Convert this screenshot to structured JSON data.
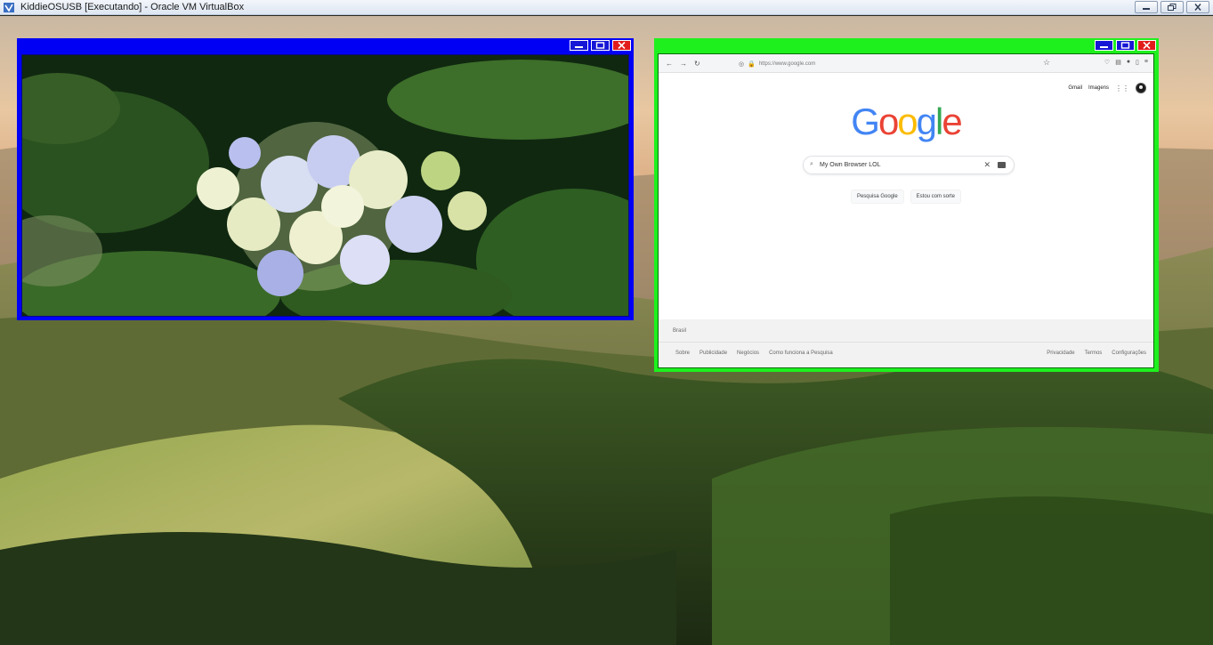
{
  "host": {
    "title": "KiddieOSUSB [Executando] - Oracle VM VirtualBox",
    "controls": [
      "minimize",
      "restore",
      "close"
    ]
  },
  "windows": {
    "image_viewer": {
      "title_color": "#0000f5",
      "image": "hydrangea flower photo"
    },
    "browser": {
      "title_color": "#1ef01e",
      "url": "https://www.google.com",
      "top_links": {
        "gmail": "Gmail",
        "images": "Imagens"
      },
      "logo": [
        "G",
        "o",
        "o",
        "g",
        "l",
        "e"
      ],
      "logo_colors": [
        "#4285f4",
        "#ea4335",
        "#fbbc05",
        "#4285f4",
        "#34a853",
        "#ea4335"
      ],
      "search": {
        "value": "My Own Browser LOL",
        "clear": "✕"
      },
      "buttons": {
        "search": "Pesquisa Google",
        "lucky": "Estou com sorte"
      },
      "footer": {
        "country": "Brasil",
        "left_links": [
          "Sobre",
          "Publicidade",
          "Negócios",
          "Como funciona a Pesquisa"
        ],
        "right_links": [
          "Privacidade",
          "Termos",
          "Configurações"
        ]
      }
    }
  }
}
